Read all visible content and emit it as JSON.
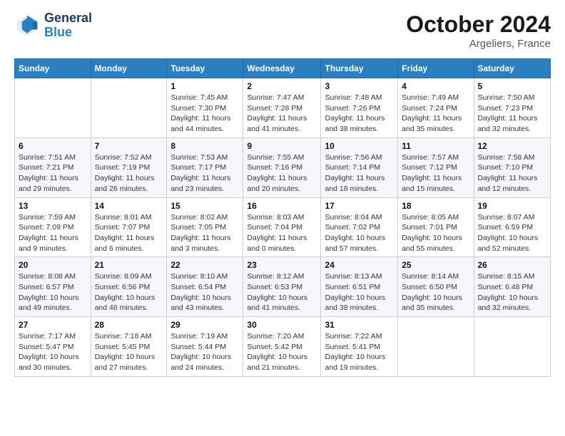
{
  "header": {
    "logo_line1": "General",
    "logo_line2": "Blue",
    "month_year": "October 2024",
    "location": "Argeliers, France"
  },
  "weekdays": [
    "Sunday",
    "Monday",
    "Tuesday",
    "Wednesday",
    "Thursday",
    "Friday",
    "Saturday"
  ],
  "weeks": [
    [
      {
        "day": "",
        "info": ""
      },
      {
        "day": "",
        "info": ""
      },
      {
        "day": "1",
        "info": "Sunrise: 7:45 AM\nSunset: 7:30 PM\nDaylight: 11 hours and 44 minutes."
      },
      {
        "day": "2",
        "info": "Sunrise: 7:47 AM\nSunset: 7:28 PM\nDaylight: 11 hours and 41 minutes."
      },
      {
        "day": "3",
        "info": "Sunrise: 7:48 AM\nSunset: 7:26 PM\nDaylight: 11 hours and 38 minutes."
      },
      {
        "day": "4",
        "info": "Sunrise: 7:49 AM\nSunset: 7:24 PM\nDaylight: 11 hours and 35 minutes."
      },
      {
        "day": "5",
        "info": "Sunrise: 7:50 AM\nSunset: 7:23 PM\nDaylight: 11 hours and 32 minutes."
      }
    ],
    [
      {
        "day": "6",
        "info": "Sunrise: 7:51 AM\nSunset: 7:21 PM\nDaylight: 11 hours and 29 minutes."
      },
      {
        "day": "7",
        "info": "Sunrise: 7:52 AM\nSunset: 7:19 PM\nDaylight: 11 hours and 26 minutes."
      },
      {
        "day": "8",
        "info": "Sunrise: 7:53 AM\nSunset: 7:17 PM\nDaylight: 11 hours and 23 minutes."
      },
      {
        "day": "9",
        "info": "Sunrise: 7:55 AM\nSunset: 7:16 PM\nDaylight: 11 hours and 20 minutes."
      },
      {
        "day": "10",
        "info": "Sunrise: 7:56 AM\nSunset: 7:14 PM\nDaylight: 11 hours and 18 minutes."
      },
      {
        "day": "11",
        "info": "Sunrise: 7:57 AM\nSunset: 7:12 PM\nDaylight: 11 hours and 15 minutes."
      },
      {
        "day": "12",
        "info": "Sunrise: 7:58 AM\nSunset: 7:10 PM\nDaylight: 11 hours and 12 minutes."
      }
    ],
    [
      {
        "day": "13",
        "info": "Sunrise: 7:59 AM\nSunset: 7:09 PM\nDaylight: 11 hours and 9 minutes."
      },
      {
        "day": "14",
        "info": "Sunrise: 8:01 AM\nSunset: 7:07 PM\nDaylight: 11 hours and 6 minutes."
      },
      {
        "day": "15",
        "info": "Sunrise: 8:02 AM\nSunset: 7:05 PM\nDaylight: 11 hours and 3 minutes."
      },
      {
        "day": "16",
        "info": "Sunrise: 8:03 AM\nSunset: 7:04 PM\nDaylight: 11 hours and 0 minutes."
      },
      {
        "day": "17",
        "info": "Sunrise: 8:04 AM\nSunset: 7:02 PM\nDaylight: 10 hours and 57 minutes."
      },
      {
        "day": "18",
        "info": "Sunrise: 8:05 AM\nSunset: 7:01 PM\nDaylight: 10 hours and 55 minutes."
      },
      {
        "day": "19",
        "info": "Sunrise: 8:07 AM\nSunset: 6:59 PM\nDaylight: 10 hours and 52 minutes."
      }
    ],
    [
      {
        "day": "20",
        "info": "Sunrise: 8:08 AM\nSunset: 6:57 PM\nDaylight: 10 hours and 49 minutes."
      },
      {
        "day": "21",
        "info": "Sunrise: 8:09 AM\nSunset: 6:56 PM\nDaylight: 10 hours and 46 minutes."
      },
      {
        "day": "22",
        "info": "Sunrise: 8:10 AM\nSunset: 6:54 PM\nDaylight: 10 hours and 43 minutes."
      },
      {
        "day": "23",
        "info": "Sunrise: 8:12 AM\nSunset: 6:53 PM\nDaylight: 10 hours and 41 minutes."
      },
      {
        "day": "24",
        "info": "Sunrise: 8:13 AM\nSunset: 6:51 PM\nDaylight: 10 hours and 38 minutes."
      },
      {
        "day": "25",
        "info": "Sunrise: 8:14 AM\nSunset: 6:50 PM\nDaylight: 10 hours and 35 minutes."
      },
      {
        "day": "26",
        "info": "Sunrise: 8:15 AM\nSunset: 6:48 PM\nDaylight: 10 hours and 32 minutes."
      }
    ],
    [
      {
        "day": "27",
        "info": "Sunrise: 7:17 AM\nSunset: 5:47 PM\nDaylight: 10 hours and 30 minutes."
      },
      {
        "day": "28",
        "info": "Sunrise: 7:18 AM\nSunset: 5:45 PM\nDaylight: 10 hours and 27 minutes."
      },
      {
        "day": "29",
        "info": "Sunrise: 7:19 AM\nSunset: 5:44 PM\nDaylight: 10 hours and 24 minutes."
      },
      {
        "day": "30",
        "info": "Sunrise: 7:20 AM\nSunset: 5:42 PM\nDaylight: 10 hours and 21 minutes."
      },
      {
        "day": "31",
        "info": "Sunrise: 7:22 AM\nSunset: 5:41 PM\nDaylight: 10 hours and 19 minutes."
      },
      {
        "day": "",
        "info": ""
      },
      {
        "day": "",
        "info": ""
      }
    ]
  ]
}
